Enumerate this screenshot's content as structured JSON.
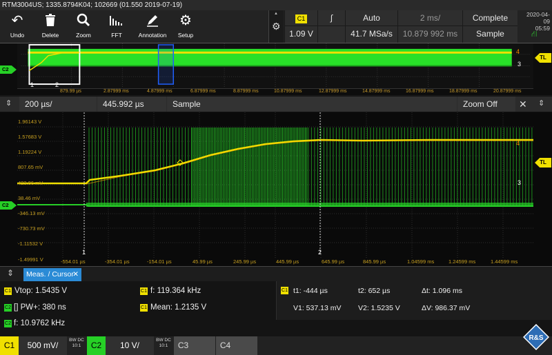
{
  "title": "RTM3004US; 1335.8794K04; 102669 (01.550 2019-07-19)",
  "toolbar": {
    "undo": "Undo",
    "delete": "Delete",
    "zoom": "Zoom",
    "fft": "FFT",
    "annotation": "Annotation",
    "setup": "Setup"
  },
  "trigger": {
    "channel": "C1",
    "slope_icon": "rising-edge-icon",
    "level": "1.09 V",
    "mode": "Auto",
    "sample_rate": "41.7 MSa/s",
    "time_scale": "2 ms/",
    "time_offset": "10.879 992 ms",
    "state": "Complete",
    "acq_mode": "Sample"
  },
  "status": {
    "date": "2020-04-09",
    "time": "05:59"
  },
  "overview": {
    "x_ticks": [
      "879.99 µs",
      "2.87999 ms",
      "4.87999 ms",
      "6.87999 ms",
      "8.87999 ms",
      "10.87999 ms",
      "12.87999 ms",
      "14.87999 ms",
      "16.87999 ms",
      "18.87999 ms",
      "20.87999 ms"
    ],
    "marker_4": "4",
    "marker_3": "3",
    "marker_1": "1",
    "marker_2": "2",
    "channel_label": "C2",
    "trigger_label": "TL"
  },
  "zoom_bar": {
    "time_scale": "200 µs/",
    "position": "445.992 µs",
    "acq_mode": "Sample",
    "zoom_off": "Zoom Off"
  },
  "main_plot": {
    "y_labels": [
      "1.96143 V",
      "1.57683 V",
      "1.19224 V",
      "807.65 mV",
      "423.06 mV",
      "38.46 mV",
      "-346.13 mV",
      "-730.73 mV",
      "-1.11532 V",
      "-1.49991 V"
    ],
    "x_labels": [
      "-554.01 µs",
      "-354.01 µs",
      "-154.01 µs",
      "45.99 µs",
      "245.99 µs",
      "445.99 µs",
      "645.99 µs",
      "845.99 µs",
      "1.04599 ms",
      "1.24599 ms",
      "1.44599 ms"
    ],
    "cursor_1": "1",
    "cursor_2": "2",
    "marker_3": "3",
    "marker_4": "4",
    "trigger_label": "TL",
    "channel_label": "C2"
  },
  "meas": {
    "tab": "Meas. / Cursor",
    "c1_vtop_label": "Vtop: 1.5435 V",
    "c1_freq_label": "f: 119.364 kHz",
    "c2_pw_label": "PW+: 380 ns",
    "c1_mean_label": "Mean: 1.2135 V",
    "c2_freq_label": "f: 10.9762 kHz",
    "tag_c1": "C1",
    "tag_c2": "C2"
  },
  "cursor": {
    "t1": "t1: -444 µs",
    "t2": "t2: 652 µs",
    "dt": "Δt: 1.096 ms",
    "v1": "V1: 537.13 mV",
    "v2": "V2: 1.5235 V",
    "dv": "ΔV: 986.37 mV"
  },
  "channels": [
    {
      "name": "C1",
      "scale": "500 mV/",
      "coupling_1": "BW DC",
      "coupling_2": "10:1"
    },
    {
      "name": "C2",
      "scale": "10 V/",
      "coupling_1": "BW DC",
      "coupling_2": "10:1"
    },
    {
      "name": "C3"
    },
    {
      "name": "C4"
    }
  ],
  "colors": {
    "ch1": "#f0e000",
    "ch2": "#26d026",
    "accent": "#2b8bd6",
    "axis_text": "#c8a020"
  }
}
